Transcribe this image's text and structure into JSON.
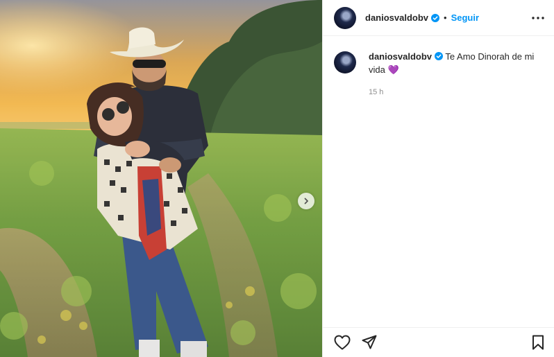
{
  "post": {
    "username": "daniosvaldobv",
    "follow_label": "Seguir",
    "separator": "•",
    "caption": "Te Amo Dinorah de mi vida",
    "caption_emoji": "💜",
    "time": "15 h"
  },
  "icons": {
    "verified": "verified-badge-icon",
    "more": "more-options-icon",
    "like": "heart-icon",
    "share": "share-icon",
    "save": "bookmark-icon",
    "next": "chevron-right-icon"
  },
  "colors": {
    "accent": "#0095f6",
    "verified": "#0095f6",
    "muted": "#8e8e8e",
    "divider": "#efefef"
  }
}
